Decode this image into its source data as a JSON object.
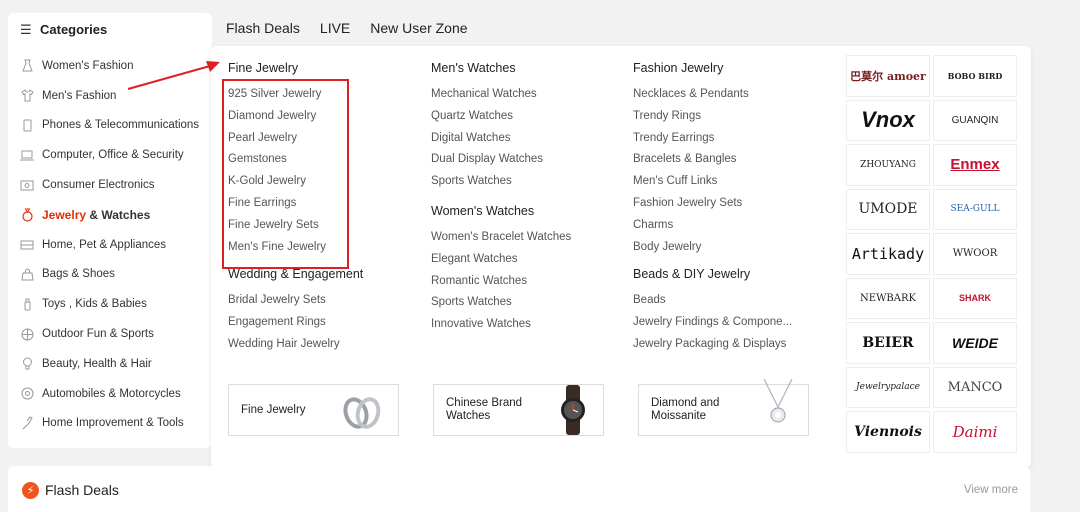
{
  "header": {
    "categories_label": "Categories",
    "nav": [
      "Flash Deals",
      "LIVE",
      "New User Zone"
    ]
  },
  "sidebar": {
    "items": [
      {
        "label": "Women's Fashion",
        "icon": "dress-icon"
      },
      {
        "label": "Men's Fashion",
        "icon": "shirt-icon"
      },
      {
        "label": "Phones & Telecommunications",
        "icon": "phone-icon"
      },
      {
        "label": "Computer, Office & Security",
        "icon": "laptop-icon"
      },
      {
        "label": "Consumer Electronics",
        "icon": "camera-icon"
      },
      {
        "label_highlight": "Jewelry",
        "label_rest": " & Watches",
        "icon": "ring-icon",
        "active": true
      },
      {
        "label": "Home, Pet & Appliances",
        "icon": "sofa-icon"
      },
      {
        "label": "Bags & Shoes",
        "icon": "bag-icon"
      },
      {
        "label": "Toys , Kids & Babies",
        "icon": "bottle-icon"
      },
      {
        "label": "Outdoor Fun & Sports",
        "icon": "ball-icon"
      },
      {
        "label": "Beauty, Health & Hair",
        "icon": "bulb-icon"
      },
      {
        "label": "Automobiles & Motorcycles",
        "icon": "wheel-icon"
      },
      {
        "label": "Home Improvement & Tools",
        "icon": "tool-icon"
      }
    ]
  },
  "menu": {
    "col1": {
      "title": "Fine Jewelry",
      "links": [
        "925 Silver Jewelry",
        "Diamond Jewelry",
        "Pearl Jewelry",
        "Gemstones",
        "K-Gold Jewelry",
        "Fine Earrings",
        "Fine Jewelry Sets",
        "Men's Fine Jewelry"
      ],
      "title2": "Wedding & Engagement",
      "links2": [
        "Bridal Jewelry Sets",
        "Engagement Rings",
        "Wedding Hair Jewelry"
      ]
    },
    "col2": {
      "title": "Men's Watches",
      "links": [
        "Mechanical Watches",
        "Quartz Watches",
        "Digital Watches",
        "Dual Display Watches",
        "Sports Watches"
      ],
      "title2": "Women's Watches",
      "links2": [
        "Women's Bracelet Watches",
        "Elegant Watches",
        "Romantic Watches",
        "Sports Watches",
        "Innovative Watches"
      ]
    },
    "col3": {
      "title": "Fashion Jewelry",
      "links": [
        "Necklaces & Pendants",
        "Trendy Rings",
        "Trendy Earrings",
        "Bracelets & Bangles",
        "Men's Cuff Links",
        "Fashion Jewelry Sets",
        "Charms",
        "Body Jewelry"
      ],
      "title2": "Beads & DIY Jewelry",
      "links2": [
        "Beads",
        "Jewelry Findings & Compone...",
        "Jewelry Packaging & Displays"
      ]
    }
  },
  "promos": [
    {
      "label": "Fine Jewelry",
      "icon": "rings-icon"
    },
    {
      "label": "Chinese Brand Watches",
      "icon": "watch-icon"
    },
    {
      "label": "Diamond and Moissanite",
      "icon": "pendant-icon"
    }
  ],
  "brands": [
    {
      "text": "巴莫尔 amoer",
      "color": "#7a1f1f"
    },
    {
      "text": "BOBO BIRD",
      "color": "#222222"
    },
    {
      "text": "Vnox",
      "color": "#111111"
    },
    {
      "text": "GUANQIN",
      "color": "#222222"
    },
    {
      "text": "ZHOUYANG",
      "color": "#222222"
    },
    {
      "text": "Enmex",
      "color": "#c8102e"
    },
    {
      "text": "UMODE",
      "color": "#222222"
    },
    {
      "text": "SEA-GULL",
      "color": "#2b5fae"
    },
    {
      "text": "Artikady",
      "color": "#111111"
    },
    {
      "text": "WWOOR",
      "color": "#222222"
    },
    {
      "text": "NEWBARK",
      "color": "#222222"
    },
    {
      "text": "SHARK",
      "color": "#c8102e"
    },
    {
      "text": "BEIER",
      "color": "#111111"
    },
    {
      "text": "WEIDE",
      "color": "#111111"
    },
    {
      "text": "Jewelrypalace",
      "color": "#222222"
    },
    {
      "text": "MANCO",
      "color": "#444444"
    },
    {
      "text": "Viennois",
      "color": "#111111"
    },
    {
      "text": "Daimi",
      "color": "#c8102e"
    }
  ],
  "flash": {
    "title": "Flash Deals",
    "view_more": "View more"
  },
  "accent": "#e62e04"
}
